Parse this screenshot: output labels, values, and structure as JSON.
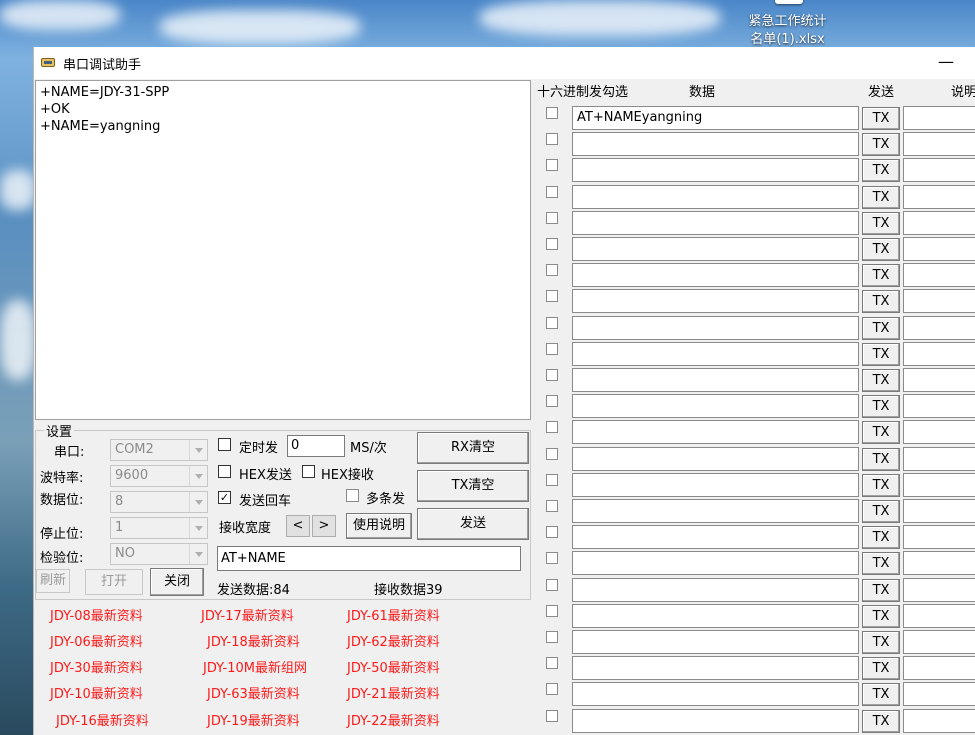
{
  "desktop": {
    "icon_label_line1": "紧急工作统计",
    "icon_label_line2": "名单(1).xlsx"
  },
  "window": {
    "title": "串口调试助手",
    "minimize_glyph": "—"
  },
  "receive": {
    "text": "+NAME=JDY-31-SPP\n+OK\n+NAME=yangning"
  },
  "settings": {
    "group_title": "设置",
    "port_label": "串口:",
    "port_value": "COM2",
    "baud_label": "波特率:",
    "baud_value": "9600",
    "databits_label": "数据位:",
    "databits_value": "8",
    "stopbits_label": "停止位:",
    "stopbits_value": "1",
    "parity_label": "检验位:",
    "parity_value": "NO",
    "refresh_button": "刷新",
    "open_button": "打开",
    "close_button": "关闭",
    "timed_send_label": "定时发",
    "timed_send_value": "0",
    "ms_unit": "MS/次",
    "hex_send_label": "HEX发送",
    "hex_recv_label": "HEX接收",
    "send_newline_label": "发送回车",
    "send_newline_checkmark": "✓",
    "multi_send_label": "多条发",
    "recv_width_label": "接收宽度",
    "width_less": "<",
    "width_more": ">",
    "help_button": "使用说明",
    "rx_clear_button": "RX清空",
    "tx_clear_button": "TX清空",
    "send_button": "发送",
    "send_input_value": "AT+NAME",
    "sent_count_label": "发送数据:84",
    "recv_count_label": "接收数据39"
  },
  "links": [
    [
      "JDY-08最新资料",
      "JDY-17最新资料",
      "JDY-61最新资料"
    ],
    [
      "JDY-06最新资料",
      "JDY-18最新资料",
      "JDY-62最新资料"
    ],
    [
      "JDY-30最新资料",
      "JDY-10M最新组网",
      "JDY-50最新资料"
    ],
    [
      "JDY-10最新资料",
      "JDY-63最新资料",
      "JDY-21最新资料"
    ],
    [
      "JDY-16最新资料",
      "JDY-19最新资料",
      "JDY-22最新资料"
    ]
  ],
  "multi_send": {
    "hex_col_header": "十六进制发勾选",
    "data_col_header": "数据",
    "send_col_header": "发送",
    "note_col_header": "说明",
    "tx_label": "TX",
    "rows": [
      "AT+NAMEyangning",
      "",
      "",
      "",
      "",
      "",
      "",
      "",
      "",
      "",
      "",
      "",
      "",
      "",
      "",
      "",
      "",
      "",
      "",
      "",
      "",
      "",
      "",
      "",
      ""
    ]
  }
}
